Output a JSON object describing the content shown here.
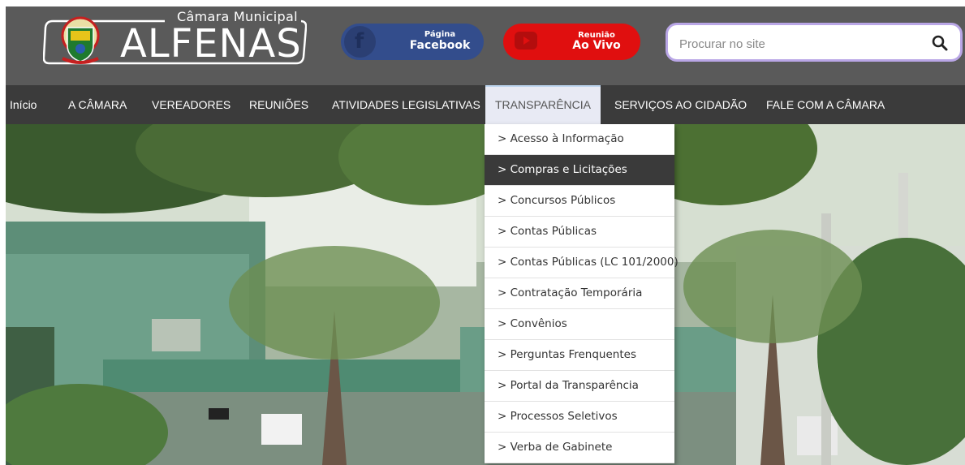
{
  "header": {
    "logo_subtitle": "Câmara Municipal",
    "logo_title": "ALFENAS",
    "facebook": {
      "line1": "Página",
      "line2": "Facebook",
      "icon": "facebook-icon",
      "color": "#334d8c"
    },
    "youtube": {
      "line1": "Reunião",
      "line2": "Ao Vivo",
      "icon": "youtube-icon",
      "color": "#e00f0f"
    },
    "search": {
      "placeholder": "Procurar no site",
      "value": "",
      "icon": "search-icon"
    }
  },
  "nav": {
    "items": [
      {
        "label": "Início"
      },
      {
        "label": "A CÂMARA"
      },
      {
        "label": "VEREADORES"
      },
      {
        "label": "REUNIÕES"
      },
      {
        "label": "ATIVIDADES LEGISLATIVAS"
      },
      {
        "label": "TRANSPARÊNCIA",
        "active": true
      },
      {
        "label": "SERVIÇOS AO CIDADÃO"
      },
      {
        "label": "FALE COM A CÂMARA"
      }
    ]
  },
  "dropdown": {
    "items": [
      {
        "label": "> Acesso à Informação"
      },
      {
        "label": "> Compras e Licitações",
        "highlighted": true
      },
      {
        "label": "> Concursos Públicos"
      },
      {
        "label": "> Contas Públicas"
      },
      {
        "label": "> Contas Públicas (LC 101/2000)"
      },
      {
        "label": "> Contratação Temporária"
      },
      {
        "label": "> Convênios"
      },
      {
        "label": "> Perguntas Frenquentes"
      },
      {
        "label": "> Portal da Transparência"
      },
      {
        "label": "> Processos Seletivos"
      },
      {
        "label": "> Verba de Gabinete"
      }
    ]
  },
  "colors": {
    "header_bg": "#5a5a5a",
    "nav_bg": "#3b3b3b",
    "search_border": "#b9a6e6",
    "highlight_bg": "#3a3a3a"
  }
}
